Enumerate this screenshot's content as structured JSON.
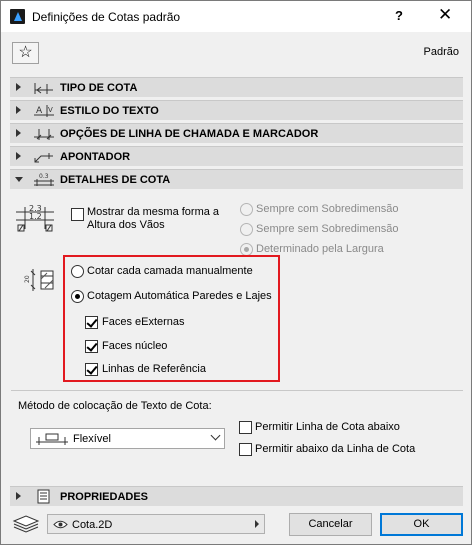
{
  "window": {
    "title": "Definições de Cotas padrão",
    "help": "?",
    "close": "✕",
    "favorites": "☆",
    "preset": "Padrão"
  },
  "panels": {
    "tipo": "TIPO DE COTA",
    "estilo": "ESTILO DO TEXTO",
    "opcoes": "OPÇÕES DE LINHA DE CHAMADA E MARCADOR",
    "apontador": "APONTADOR",
    "detalhes": "DETALHES DE COTA",
    "propriedades": "PROPRIEDADES"
  },
  "detalhes": {
    "icon_top": "2.3",
    "icon_bottom": "1.2",
    "mesma_forma_line1": "Mostrar da mesma forma a",
    "mesma_forma_line2": "Altura dos Vãos",
    "sempre_com": "Sempre com Sobredimensão",
    "sempre_sem": "Sempre sem Sobredimensão",
    "determinado": "Determinado pela Largura",
    "layer_icon_num": "20",
    "cotar_manual": "Cotar cada camada manualmente",
    "cotagem_auto": "Cotagem Automática Paredes e Lajes",
    "faces_externas": "Faces eExternas",
    "faces_nucleo": "Faces núcleo",
    "linhas_ref": "Linhas de Referência"
  },
  "metodo": {
    "label": "Método de colocação de Texto de Cota:",
    "selected": "Flexível",
    "permitir_abaixo": "Permitir Linha de Cota abaixo",
    "permitir_abaixo_da": "Permitir abaixo da Linha de Cota"
  },
  "footer": {
    "layer": "Cota.2D",
    "cancel": "Cancelar",
    "ok": "OK"
  },
  "colors": {
    "highlight": "#e2191f",
    "ok_border": "#0078d7"
  }
}
